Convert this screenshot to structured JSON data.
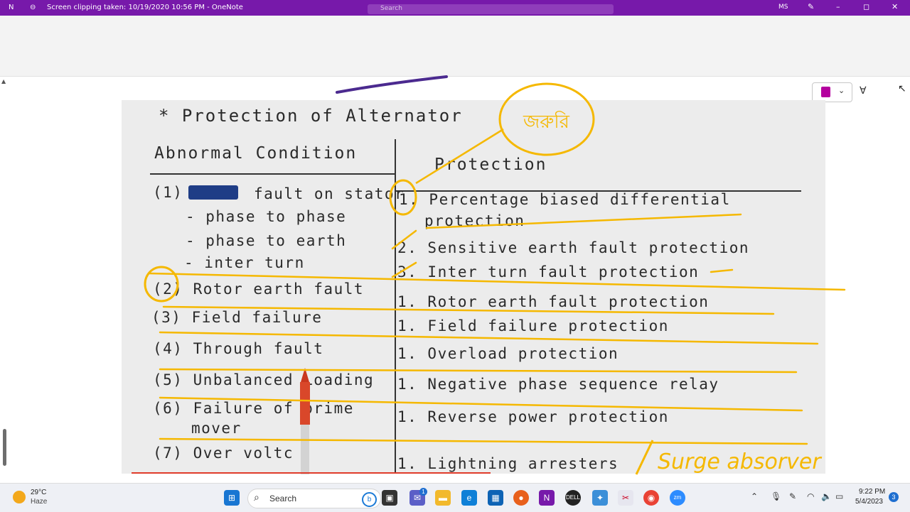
{
  "window": {
    "title": "Screen clipping taken: 10/19/2020 10:56 PM  -  OneNote",
    "search_placeholder": "Search",
    "user_initials": "MS"
  },
  "clipping": {
    "title": "* Protection of Alternator",
    "col_left": "Abnormal Condition",
    "col_right": "Protection",
    "left_rows": [
      "(1)",
      "fault on stator",
      "- phase to phase",
      "- phase to earth",
      "- inter turn",
      "(2) Rotor earth fault",
      "(3) Field failure",
      "(4) Through fault",
      "(5) Unbalanced Loading",
      "(6) Failure of prime",
      "mover",
      "(7) Over voltc"
    ],
    "right_rows": [
      "1. Percentage biased differential",
      "protection",
      "2. Sensitive earth fault protection",
      "3. Inter turn fault protection",
      "1. Rotor earth fault protection",
      "1. Field failure protection",
      "1. Overload protection",
      "1. Negative phase sequence relay",
      "1. Reverse power protection",
      "1. Lightning arresters"
    ],
    "handwritten_note": "Surge absorver",
    "handwritten_bengali": "জরুরি"
  },
  "toolbar": {
    "notebook_color": "#b4009e"
  },
  "taskbar": {
    "weather_temp": "29°C",
    "weather_desc": "Haze",
    "search_label": "Search",
    "chat_badge": "1",
    "time": "9:22 PM",
    "date": "5/4/2023",
    "notification_count": "3"
  },
  "colors": {
    "title_bar": "#7719aa",
    "annotation": "#f5b800",
    "taskbar": "#eef0f5"
  }
}
